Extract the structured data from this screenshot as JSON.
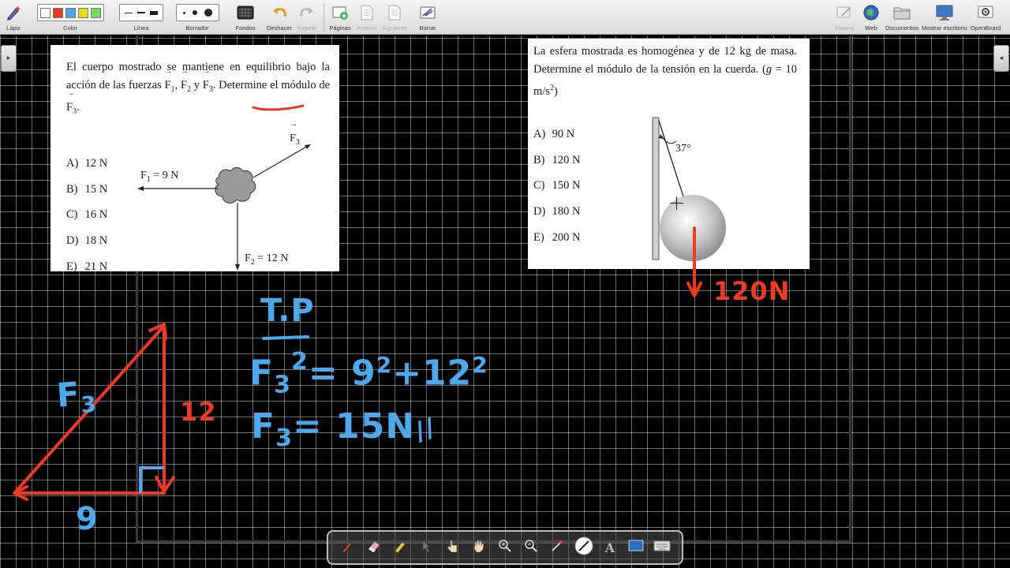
{
  "toolbar": {
    "items": [
      {
        "label": "Lápiz",
        "icon": "pen-icon"
      },
      {
        "label": "Color",
        "icon": "color-palette"
      },
      {
        "label": "Línea",
        "icon": "line-width"
      },
      {
        "label": "Borrador",
        "icon": "eraser-size"
      },
      {
        "label": "Fondos",
        "icon": "background-icon"
      },
      {
        "label": "Deshacer",
        "icon": "undo-icon"
      },
      {
        "label": "Repetir",
        "icon": "redo-icon"
      },
      {
        "label": "Páginas",
        "icon": "add-page-icon"
      },
      {
        "label": "Anterior",
        "icon": "previous-page-icon"
      },
      {
        "label": "Siguiente",
        "icon": "next-page-icon"
      },
      {
        "label": "Borrar",
        "icon": "clear-page-icon"
      },
      {
        "label": "Pizarra",
        "icon": "board-icon"
      },
      {
        "label": "Web",
        "icon": "globe-icon"
      },
      {
        "label": "Documentos",
        "icon": "folder-icon"
      },
      {
        "label": "Mostrar escritorio",
        "icon": "desktop-icon"
      },
      {
        "label": "OpenBoard",
        "icon": "gear-icon"
      }
    ],
    "colors": [
      "#ffffff",
      "#e53b1e",
      "#4aa3ee",
      "#e0e020",
      "#6ee05a"
    ]
  },
  "problem1": {
    "text_a": "El cuerpo mostrado se mantiene en ",
    "text_highlight": "equilibrio",
    "text_b": " bajo la acción de las fuerzas ",
    "f": "F",
    "s1": "1",
    "s2": "2",
    "s3": "3",
    "sep1": ", ",
    "sep2": " y ",
    "text_c": ". Determine el módulo de ",
    "text_d": ".",
    "options": [
      {
        "key": "A)",
        "value": "12 N"
      },
      {
        "key": "B)",
        "value": "15 N"
      },
      {
        "key": "C)",
        "value": "16 N"
      },
      {
        "key": "D)",
        "value": "18 N"
      },
      {
        "key": "E)",
        "value": "21 N"
      }
    ],
    "f1_label": "F",
    "f1_sub": "1",
    "f1_val": " = 9 N",
    "f2_label": "F",
    "f2_sub": "2",
    "f2_val": " = 12 N",
    "f3_label": "F",
    "f3_sub": "3"
  },
  "problem2": {
    "text": "La esfera mostrada es homogénea y de 12 kg de masa. Determine el módulo de la tensión en la cuerda. (",
    "g": "g",
    "g_rest": " = 10 m/s",
    "g_exp": "2",
    "close": ")",
    "angle": "37°",
    "options": [
      {
        "key": "A)",
        "value": "90 N"
      },
      {
        "key": "B)",
        "value": "120 N"
      },
      {
        "key": "C)",
        "value": "150 N"
      },
      {
        "key": "D)",
        "value": "180 N"
      },
      {
        "key": "E)",
        "value": "200 N"
      }
    ]
  },
  "annotations": {
    "tp": "T.P",
    "eq1_lhs": "F",
    "eq1_sub": "3",
    "eq1_exp": "2",
    "eq1_rhs_a": "= 9",
    "eq1_exp_b": "2",
    "eq1_rhs_b": "+12",
    "eq1_exp_c": "2",
    "eq2_lhs": "F",
    "eq2_sub": "3",
    "eq2_rhs": "= 15N",
    "eq2_mark": "//",
    "tri_hyp": "F",
    "tri_hyp_sub": "3",
    "tri_side": "12",
    "tri_base": "9",
    "weight": "120N"
  }
}
